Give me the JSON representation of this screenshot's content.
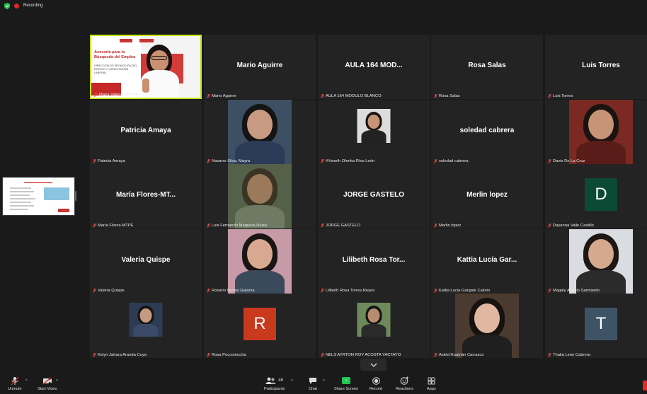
{
  "topbar": {
    "recording_label": "Recording"
  },
  "participants": [
    {
      "display": "",
      "label": "Maira Valencia MTPE",
      "kind": "presenter"
    },
    {
      "display": "Mario Aguirre",
      "label": "Mario Aguirre",
      "kind": "name"
    },
    {
      "display": "AULA 164 MOD...",
      "label": "AULA 164 MODULO BLANCO",
      "kind": "name"
    },
    {
      "display": "Rosa Salas",
      "label": "Rosa Salas",
      "kind": "name"
    },
    {
      "display": "Luis Torres",
      "label": "Luis Torres",
      "kind": "name"
    },
    {
      "display": "Patricia Amaya",
      "label": "Patricia Amaya",
      "kind": "name"
    },
    {
      "display": "",
      "label": "Navarro Silva, Mayra",
      "kind": "photo",
      "bg": "#3d4f63",
      "skin": "#c89a82",
      "hair": "#141414",
      "shirt": "#2b3b58"
    },
    {
      "display": "",
      "label": "#Yaneth Olenka Ríos León",
      "kind": "small",
      "bg": "#dcdcdc",
      "skin": "#c79478",
      "hair": "#1c1410",
      "shirt": "#222222"
    },
    {
      "display": "soledad cabrera",
      "label": "soledad cabrera",
      "kind": "name"
    },
    {
      "display": "",
      "label": "Davis De La Cruz",
      "kind": "photo",
      "bg": "#7a2a22",
      "skin": "#c79477",
      "hair": "#1a1410",
      "shirt": "#5a1c18"
    },
    {
      "display": "María Flores-MT...",
      "label": "María Flores-MTPE",
      "kind": "name"
    },
    {
      "display": "",
      "label": "Luis Fernando Maquera Huisa",
      "kind": "photo",
      "bg": "#55604a",
      "skin": "#9a7a5a",
      "hair": "#3a3424",
      "shirt": "#6e7a64"
    },
    {
      "display": "JORGE GASTELO",
      "label": "JORGE GASTELO",
      "kind": "name"
    },
    {
      "display": "Merlin lopez",
      "label": "Merlin lopez",
      "kind": "name"
    },
    {
      "display": "",
      "label": "Dayanna Valle Castillo",
      "kind": "letter",
      "letter": "D",
      "color": "#0b4a34"
    },
    {
      "display": "Valeria Quispe",
      "label": "Valeria Quispe",
      "kind": "name"
    },
    {
      "display": "",
      "label": "Rosario Quinto Galarza",
      "kind": "photo",
      "bg": "#c79aa8",
      "skin": "#d8a990",
      "hair": "#1a1414",
      "shirt": "#3a4a5a"
    },
    {
      "display": "Lilibeth Rosa Tor...",
      "label": "Lilibeth Rosa Torres Reyes",
      "kind": "name"
    },
    {
      "display": "Kattia Lucía Gar...",
      "label": "Kattia Lucia Gargate Calixto",
      "kind": "name"
    },
    {
      "display": "",
      "label": "Magaly Angulo Sarmiento",
      "kind": "photo",
      "bg": "#d9dde2",
      "skin": "#d4a98e",
      "hair": "#1c1714",
      "shirt": "#2b2b2b"
    },
    {
      "display": "",
      "label": "Kelyn Jahara Aranda Cuya",
      "kind": "small",
      "bg": "#2d3c52",
      "skin": "#c59a80",
      "hair": "#141414",
      "shirt": "#3c4a6a"
    },
    {
      "display": "",
      "label": "Rosa Poccomucha",
      "kind": "letter",
      "letter": "R",
      "color": "#c8391e"
    },
    {
      "display": "",
      "label": "NELS AYRTON ROY ACOSTA YACTAYO",
      "kind": "small",
      "bg": "#6e8a5a",
      "skin": "#b98c6e",
      "hair": "#141414",
      "shirt": "#2a2a2a"
    },
    {
      "display": "",
      "label": "Astrid Huamán Carrasco",
      "kind": "photo",
      "bg": "#4a3a30",
      "skin": "#e0b8a2",
      "hair": "#171210",
      "shirt": "#1f1f1f"
    },
    {
      "display": "",
      "label": "Thalia Leon Cabrera",
      "kind": "letter",
      "letter": "T",
      "color": "#3e5466"
    }
  ],
  "slide": {
    "line1": "Asesoría para la",
    "line2": "Búsqueda del Empleo",
    "subtitle": "DIRECCIÓN DE PROMOCIÓN DEL EMPLEO Y CAPACITACIÓN LABORAL"
  },
  "toolbar": {
    "unmute": "Unmute",
    "start_video": "Start Video",
    "participants": "Participants",
    "participants_count": "46",
    "chat": "Chat",
    "share_screen": "Share Screen",
    "record": "Record",
    "reactions": "Reactions",
    "apps": "Apps"
  },
  "colors": {
    "active_border": "#c8e21b",
    "share_green": "#23c552",
    "muted_red": "#e02828"
  }
}
